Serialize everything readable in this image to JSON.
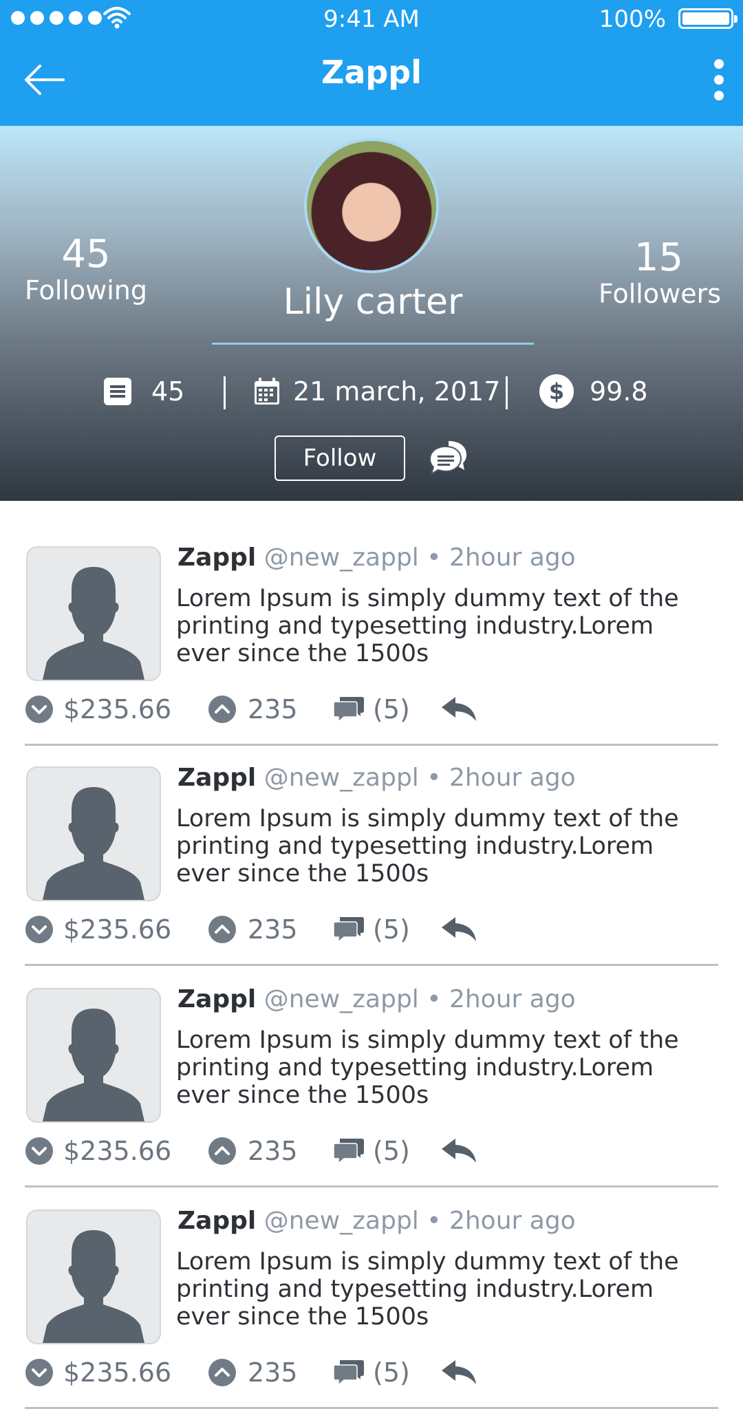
{
  "status_bar": {
    "time": "9:41 AM",
    "battery": "100%"
  },
  "nav": {
    "title": "Zappl"
  },
  "profile": {
    "name": "Lily carter",
    "following_count": "45",
    "following_label": "Following",
    "followers_count": "15",
    "followers_label": "Followers",
    "posts_count": "45",
    "joined_date": "21 march, 2017",
    "balance": "99.8",
    "follow_label": "Follow"
  },
  "posts": [
    {
      "author": "Zappl",
      "handle": "@new_zappl",
      "separator": "•",
      "time": "2hour ago",
      "text": "Lorem Ipsum is simply dummy text of the printing and typesetting industry.Lorem ever since the 1500s",
      "amount": "$235.66",
      "votes": "235",
      "comments": "(5)"
    },
    {
      "author": "Zappl",
      "handle": "@new_zappl",
      "separator": "•",
      "time": "2hour ago",
      "text": "Lorem Ipsum is simply dummy text of the printing and typesetting industry.Lorem ever since the 1500s",
      "amount": "$235.66",
      "votes": "235",
      "comments": "(5)"
    },
    {
      "author": "Zappl",
      "handle": "@new_zappl",
      "separator": "•",
      "time": "2hour ago",
      "text": "Lorem Ipsum is simply dummy text of the printing and typesetting industry.Lorem ever since the 1500s",
      "amount": "$235.66",
      "votes": "235",
      "comments": "(5)"
    },
    {
      "author": "Zappl",
      "handle": "@new_zappl",
      "separator": "•",
      "time": "2hour ago",
      "text": "Lorem Ipsum is simply dummy text of the printing and typesetting industry.Lorem ever since the 1500s",
      "amount": "$235.66",
      "votes": "235",
      "comments": "(5)"
    }
  ],
  "colors": {
    "brand": "#1f9ff0",
    "accent_line": "#94cbef",
    "text_dark": "#2d3136",
    "text_muted": "#8d99a6",
    "icon_gray": "#6b7580"
  },
  "icons": [
    "signal-dots",
    "wifi-icon",
    "battery-icon",
    "back-arrow-icon",
    "more-vertical-icon",
    "posts-icon",
    "calendar-icon",
    "dollar-icon",
    "chat-bubbles-icon",
    "downvote-icon",
    "upvote-icon",
    "comment-icon",
    "reply-icon",
    "user-silhouette-icon"
  ]
}
